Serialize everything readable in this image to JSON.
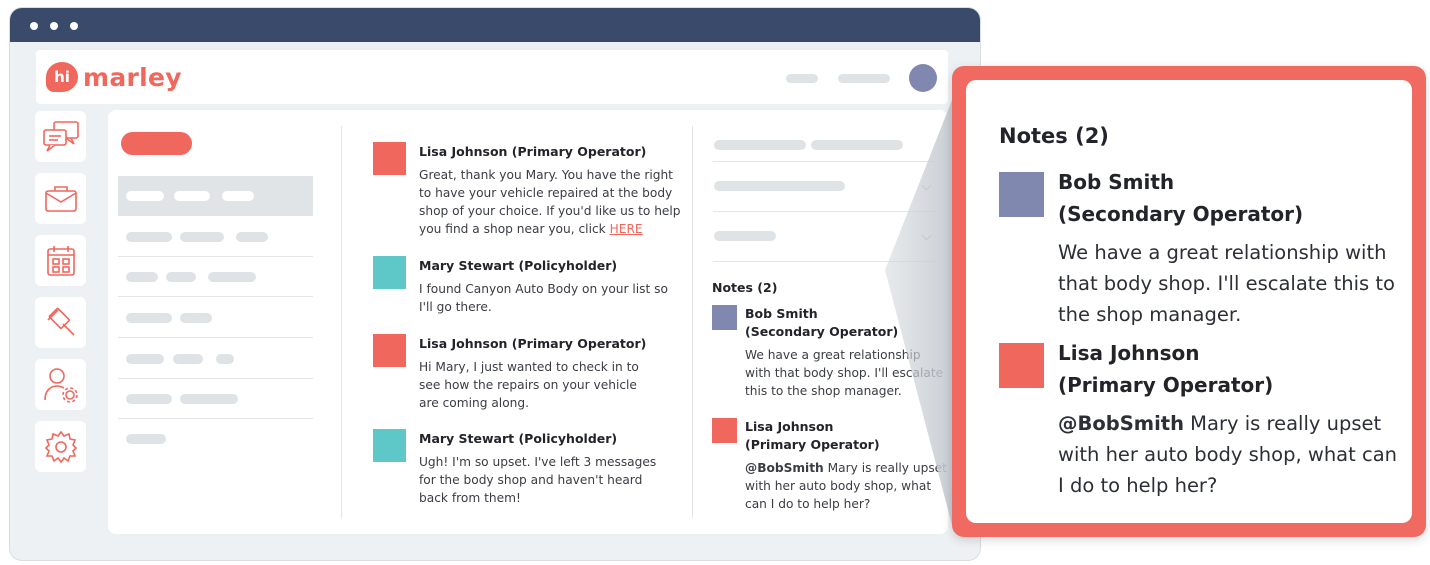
{
  "app": {
    "logo_mark": "hi",
    "logo_text": "marley"
  },
  "colors": {
    "brand": "#f0675d",
    "titlebar": "#3a4a6a",
    "operator_square": "#f0675d",
    "policyholder_square": "#5ec8c8",
    "secondary_square": "#8088b0"
  },
  "nav": {
    "icons": [
      "chat-bubbles-icon",
      "briefcase-icon",
      "calendar-icon",
      "gavel-icon",
      "user-settings-icon",
      "gear-icon"
    ]
  },
  "messages": [
    {
      "author": "Lisa Johnson (Primary Operator)",
      "text": "Great, thank you Mary. You have the right to have your vehicle repaired at the body shop of your choice. If you'd like us to help you find a shop near you, click ",
      "link": "HERE"
    },
    {
      "author": "Mary Stewart (Policyholder)",
      "text": "I found Canyon Auto Body on your list so I'll go there."
    },
    {
      "author": "Lisa Johnson (Primary Operator)",
      "text": "Hi Mary, I just wanted to check in to see how the repairs on your vehicle are coming along."
    },
    {
      "author": "Mary Stewart (Policyholder)",
      "text": "Ugh! I'm so upset. I've left 3 messages for the body shop and haven't heard back from them!"
    }
  ],
  "notes": {
    "title": "Notes (2)",
    "items": [
      {
        "name_line1": "Bob Smith",
        "name_line2": "(Secondary Operator)",
        "text": "We have a great relationship with that body shop. I'll escalate this to the shop manager."
      },
      {
        "name_line1": "Lisa Johnson",
        "name_line2": "(Primary Operator)",
        "mention": "@BobSmith",
        "text": " Mary is really upset with her auto body shop, what can I do to help her?"
      }
    ]
  }
}
